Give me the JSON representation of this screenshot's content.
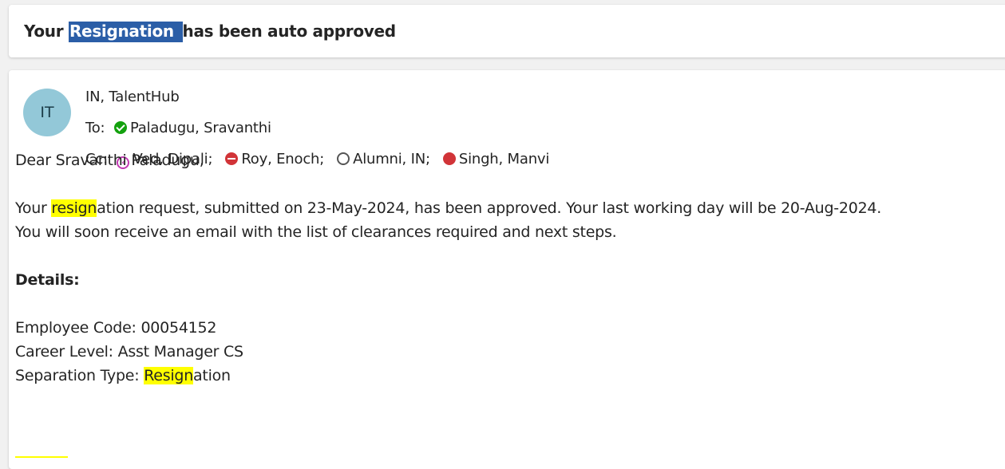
{
  "subject": {
    "prefix": "Your ",
    "highlight": "Resignation ",
    "suffix": "has been auto approved"
  },
  "message": {
    "avatar_initials": "IT",
    "from": "IN, TalentHub",
    "to_label": "To:",
    "to": [
      {
        "name": "Paladugu, Sravanthi",
        "presence": "available-icon"
      }
    ],
    "cc_label": "Cc:",
    "cc": [
      {
        "name": "Ved, Dipali;",
        "presence": "away-icon"
      },
      {
        "name": "Roy, Enoch;",
        "presence": "do-not-disturb-icon"
      },
      {
        "name": "Alumni, IN;",
        "presence": "offline-icon"
      },
      {
        "name": "Singh, Manvi",
        "presence": "busy-icon"
      }
    ],
    "greeting": "Dear Sravanthi Paladugu,",
    "line1_pre": "Your ",
    "line1_hl": "resign",
    "line1_post": "ation request, submitted on 23-May-2024, has been approved. Your last working day will be 20-Aug-2024.",
    "line2": "You will soon receive an email with the list of clearances required and next steps.",
    "details_heading": "Details:",
    "employee_code": "Employee Code: 00054152",
    "career_level": "Career Level: Asst Manager CS",
    "separation_pre": "Separation Type: ",
    "separation_hl": "Resign",
    "separation_post": "ation"
  },
  "colors": {
    "selection": "#2b5ea7",
    "highlight": "#ffff00",
    "avatar": "#93c8d8",
    "available": "#13a10e",
    "busy": "#d13438",
    "away": "#c239b3"
  }
}
